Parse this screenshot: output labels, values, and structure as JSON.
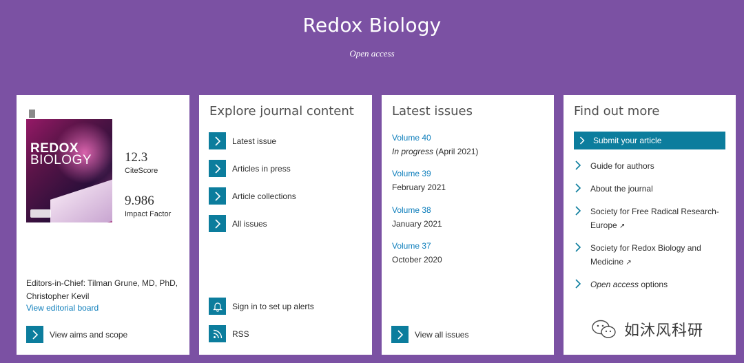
{
  "header": {
    "title": "Redox Biology",
    "subtitle": "Open access"
  },
  "journal_card": {
    "cover": {
      "title_line1": "REDOX",
      "title_line2": "BIOLOGY"
    },
    "citescore_value": "12.3",
    "citescore_label": "CiteScore",
    "impact_value": "9.986",
    "impact_label": "Impact Factor",
    "editors_text": "Editors-in-Chief: Tilman Grune, MD, PhD, Christopher Kevil",
    "editorial_board_link": "View editorial board",
    "aims_scope": "View aims and scope"
  },
  "explore": {
    "title": "Explore journal content",
    "items": [
      {
        "label": "Latest issue"
      },
      {
        "label": "Articles in press"
      },
      {
        "label": "Article collections"
      },
      {
        "label": "All issues"
      }
    ],
    "alerts": "Sign in to set up alerts",
    "rss": "RSS"
  },
  "latest_issues": {
    "title": "Latest issues",
    "issues": [
      {
        "volume": "Volume 40",
        "status": "In progress",
        "date": "(April 2021)"
      },
      {
        "volume": "Volume 39",
        "date": "February 2021"
      },
      {
        "volume": "Volume 38",
        "date": "January 2021"
      },
      {
        "volume": "Volume 37",
        "date": "October 2020"
      }
    ],
    "view_all": "View all issues"
  },
  "find_more": {
    "title": "Find out more",
    "submit": "Submit your article",
    "links": [
      {
        "label": "Guide for authors"
      },
      {
        "label": "About the journal"
      },
      {
        "label": "Society for Free Radical Research-Europe",
        "external": "↗"
      },
      {
        "label": "Society for Redox Biology and Medicine",
        "external": "↗"
      },
      {
        "label_italic": "Open access",
        "label_rest": " options"
      }
    ]
  },
  "watermark": {
    "text": "如沐风科研"
  },
  "colors": {
    "background": "#7b51a3",
    "accent": "#0c7d9d",
    "link": "#0c7dbb"
  }
}
